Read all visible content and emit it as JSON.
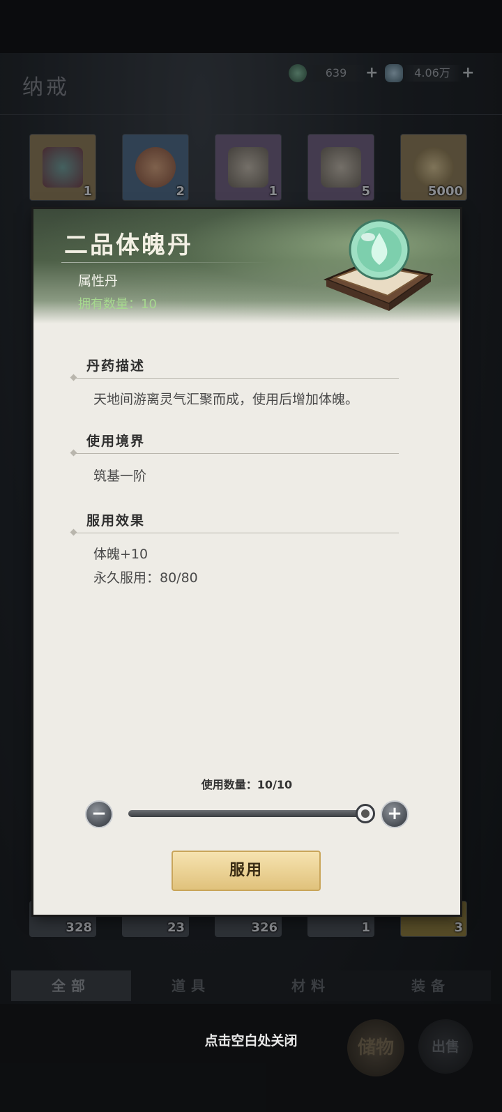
{
  "header": {
    "title": "纳戒",
    "currencies": [
      {
        "icon": "jade-coin-icon",
        "value": "639"
      },
      {
        "icon": "spirit-stone-icon",
        "value": "4.06万"
      }
    ]
  },
  "inventory": {
    "row1": [
      {
        "icon": "gift-box-icon",
        "count": "1"
      },
      {
        "icon": "egg-icon",
        "count": "2"
      },
      {
        "icon": "chest-icon",
        "count": "1"
      },
      {
        "icon": "chest-icon",
        "count": "5"
      },
      {
        "icon": "wheat-icon",
        "count": "5000"
      }
    ],
    "row_bottom": [
      {
        "icon": "item-icon",
        "count": "328"
      },
      {
        "icon": "item-icon",
        "count": "23"
      },
      {
        "icon": "item-icon",
        "count": "326"
      },
      {
        "icon": "item-icon",
        "count": "1"
      },
      {
        "icon": "item-icon",
        "count": "3"
      }
    ]
  },
  "tabs": [
    "全部",
    "道具",
    "材料",
    "装备"
  ],
  "active_tab": "全部",
  "bottom": {
    "close_hint": "点击空白处关闭",
    "storage_label": "储物",
    "sell_label": "出售"
  },
  "modal": {
    "item_name": "二品体魄丹",
    "item_type": "属性丹",
    "owned_label": "拥有数量：10",
    "sections": {
      "desc_title": "丹药描述",
      "desc_text": "天地间游离灵气汇聚而成，使用后增加体魄。",
      "realm_title": "使用境界",
      "realm_text": "筑基一阶",
      "effect_title": "服用效果",
      "effect_line1": "体魄+10",
      "effect_line2": "永久服用：80/80"
    },
    "quantity_label": "使用数量：10/10",
    "quantity": {
      "current": 10,
      "max": 10
    },
    "minus_symbol": "−",
    "plus_symbol": "+",
    "use_button": "服用"
  },
  "colors": {
    "owned_green": "#a6d88f",
    "button_gold": "#e0c27c"
  }
}
